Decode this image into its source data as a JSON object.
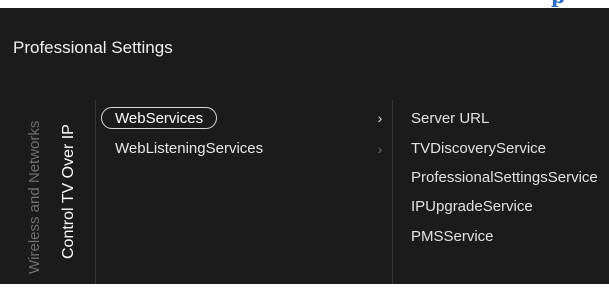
{
  "top_strip": {
    "glyph": "p",
    "glyph_color": "#2d6fc8"
  },
  "screen": {
    "background": "#1b1b1b"
  },
  "page_title": "Professional Settings",
  "breadcrumb": {
    "parent": "Wireless and Networks",
    "current": "Control TV Over IP"
  },
  "menu": {
    "items": [
      {
        "label": "WebServices",
        "selected": true,
        "chevron": "›",
        "chevron_icon": "chevron-right-icon"
      },
      {
        "label": "WebListeningServices",
        "selected": false,
        "chevron": "›",
        "chevron_icon": "chevron-right-icon"
      }
    ]
  },
  "submenu": {
    "items": [
      {
        "label": "Server URL"
      },
      {
        "label": "TVDiscoveryService"
      },
      {
        "label": "ProfessionalSettingsService"
      },
      {
        "label": "IPUpgradeService"
      },
      {
        "label": "PMSService"
      }
    ]
  }
}
